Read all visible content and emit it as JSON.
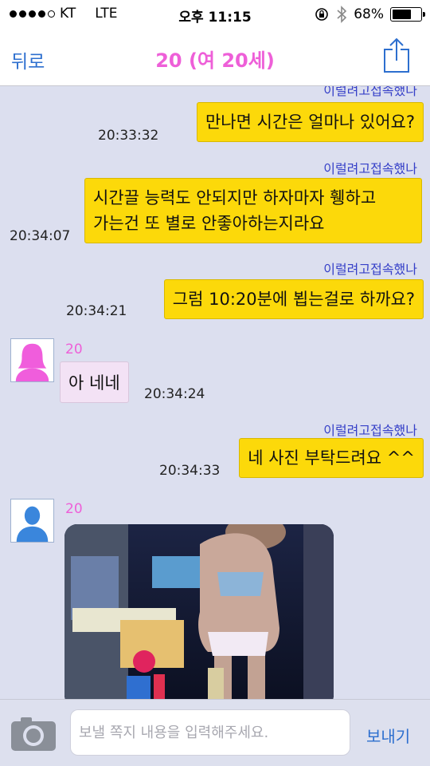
{
  "status_bar": {
    "carrier": "KT",
    "network": "LTE",
    "time": "오후 11:15",
    "battery": "68%",
    "battery_level": 0.68
  },
  "nav": {
    "back_label": "뒤로",
    "title": "20 (여 20세)",
    "share_icon": "share-icon",
    "accent": "#2d6fcf",
    "title_color": "#ee5fd8"
  },
  "messages": [
    {
      "type": "note",
      "text": "이럴려고접속했나"
    },
    {
      "type": "outgoing",
      "text": "만나면 시간은 얼마나 있어요?",
      "time": "20:33:32"
    },
    {
      "type": "note",
      "text": "이럴려고접속했나"
    },
    {
      "type": "outgoing",
      "lines": [
        "시간끌 능력도 안되지만 하자마자 휑하고",
        "가는건 또 별로 안좋아하는지라요"
      ],
      "time": "20:34:07"
    },
    {
      "type": "note",
      "text": "이럴려고접속했나"
    },
    {
      "type": "outgoing",
      "text": "그럼 10:20분에 뵙는걸로 하까요?",
      "time": "20:34:21"
    },
    {
      "type": "incoming",
      "name": "20",
      "avatar": "female-avatar-icon",
      "text": "아 네네",
      "time": "20:34:24"
    },
    {
      "type": "note",
      "text": "이럴려고접속했나"
    },
    {
      "type": "outgoing",
      "text": "네 사진 부탁드려요 ^^",
      "time": "20:34:33"
    },
    {
      "type": "incoming",
      "name": "20",
      "avatar": "male-avatar-icon",
      "image": "photo"
    }
  ],
  "input": {
    "placeholder": "보낼 쪽지 내용을 입력해주세요.",
    "value": "",
    "send_label": "보내기",
    "camera_icon": "camera-icon"
  },
  "colors": {
    "outgoing_bubble": "#fcd90a",
    "incoming_bubble": "#f3e2f5",
    "chat_background": "#dcdfef",
    "note_text": "#3640c8"
  }
}
